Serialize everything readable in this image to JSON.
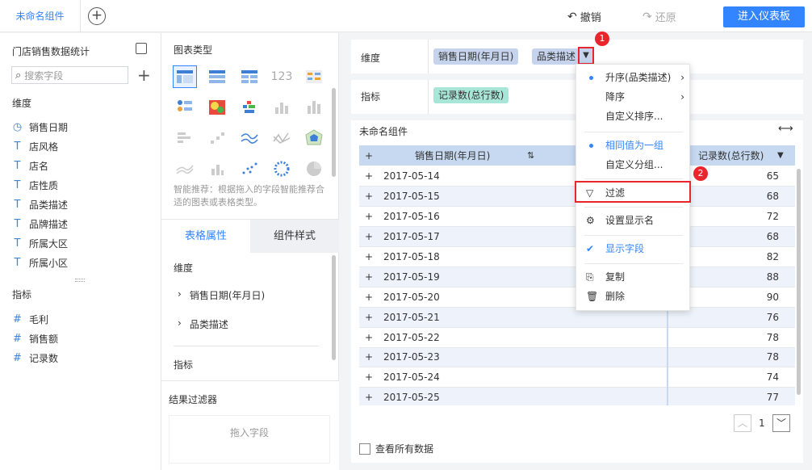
{
  "topbar": {
    "tab": "未命名组件",
    "undo": "撤销",
    "redo": "还原",
    "enter": "进入仪表板"
  },
  "sidebar": {
    "title": "门店销售数据统计",
    "search_placeholder": "搜索字段",
    "dim_label": "维度",
    "dims": [
      "销售日期",
      "店风格",
      "店名",
      "店性质",
      "品类描述",
      "品牌描述",
      "所属大区",
      "所属小区"
    ],
    "measure_label": "指标",
    "measures": [
      "毛利",
      "销售额",
      "记录数"
    ]
  },
  "mid": {
    "chart_type": "图表类型",
    "hint": "智能推荐：根据拖入的字段智能推荐合适的图表或表格类型。",
    "tab1": "表格属性",
    "tab2": "组件样式",
    "dim": "维度",
    "dim_items": [
      "销售日期(年月日)",
      "品类描述"
    ],
    "measure": "指标",
    "filter": "结果过滤器",
    "drop": "拖入字段"
  },
  "config": {
    "dim_label": "维度",
    "dim_tags": [
      "销售日期(年月日)",
      "品类描述"
    ],
    "measure_label": "指标",
    "measure_tags": [
      "记录数(总行数)"
    ]
  },
  "table": {
    "title": "未命名组件",
    "headers": [
      "销售日期(年月日)",
      "记录数(总行数)"
    ],
    "rows": [
      [
        "2017-05-14",
        "65"
      ],
      [
        "2017-05-15",
        "68"
      ],
      [
        "2017-05-16",
        "72"
      ],
      [
        "2017-05-17",
        "68"
      ],
      [
        "2017-05-18",
        "82"
      ],
      [
        "2017-05-19",
        "88"
      ],
      [
        "2017-05-20",
        "90"
      ],
      [
        "2017-05-21",
        "76"
      ],
      [
        "2017-05-22",
        "78"
      ],
      [
        "2017-05-23",
        "78"
      ],
      [
        "2017-05-24",
        "74"
      ],
      [
        "2017-05-25",
        "77"
      ]
    ],
    "page": "1",
    "view_all": "查看所有数据"
  },
  "menu": {
    "asc": "升序(品类描述)",
    "desc": "降序",
    "custom_sort": "自定义排序...",
    "same_group": "相同值为一组",
    "custom_group": "自定义分组...",
    "filter": "过滤",
    "display_name": "设置显示名",
    "show_field": "显示字段",
    "copy": "复制",
    "delete": "删除"
  },
  "badges": {
    "one": "1",
    "two": "2"
  },
  "colors": {
    "accent": "#3385ff",
    "highlight": "#e8262b"
  }
}
